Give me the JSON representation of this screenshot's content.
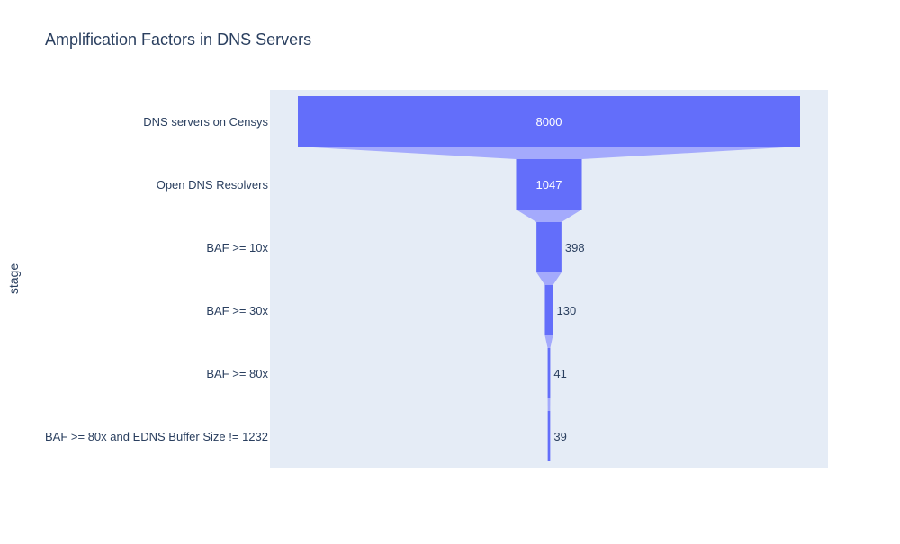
{
  "chart_data": {
    "type": "funnel",
    "title": "Amplification Factors in DNS Servers",
    "ylabel": "stage",
    "categories": [
      "DNS servers on Censys",
      "Open DNS Resolvers",
      "BAF >= 10x",
      "BAF >= 30x",
      "BAF >= 80x",
      "BAF >= 80x and EDNS Buffer Size != 1232"
    ],
    "values": [
      8000,
      1047,
      398,
      130,
      41,
      39
    ],
    "colors": {
      "bar": "#636efa",
      "connector": "#a4aafc",
      "plot_bg": "#e5ecf6",
      "text_dark": "#2a3f5f",
      "text_light": "#ffffff"
    }
  }
}
